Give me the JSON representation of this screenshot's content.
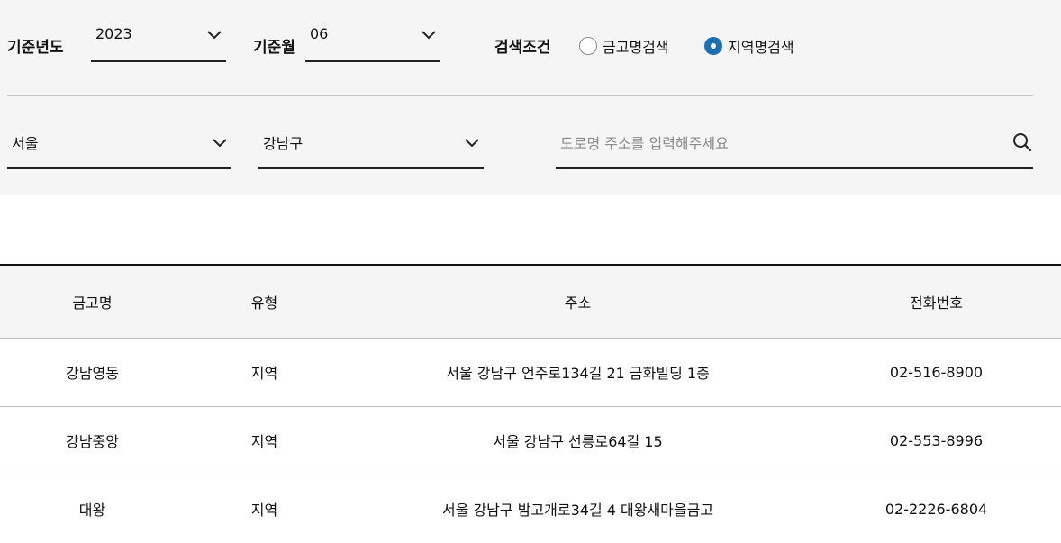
{
  "filters": {
    "year_label": "기준년도",
    "year_value": "2023",
    "month_label": "기준월",
    "month_value": "06",
    "search_condition_label": "검색조건",
    "radio_options": [
      {
        "label": "금고명검색",
        "checked": false
      },
      {
        "label": "지역명검색",
        "checked": true
      }
    ],
    "region_value": "서울",
    "district_value": "강남구",
    "address_placeholder": "도로명 주소를 입력해주세요",
    "address_value": ""
  },
  "table": {
    "headers": [
      "금고명",
      "유형",
      "주소",
      "전화번호"
    ],
    "rows": [
      [
        "강남영동",
        "지역",
        "서울 강남구 언주로134길 21 금화빌딩 1층",
        "02-516-8900"
      ],
      [
        "강남중앙",
        "지역",
        "서울 강남구 선릉로64길 15",
        "02-553-8996"
      ],
      [
        "대왕",
        "지역",
        "서울 강남구 밤고개로34길 4 대왕새마을금고",
        "02-2226-6804"
      ]
    ]
  },
  "colors": {
    "panel_bg": "#f5f5f5",
    "accent_radio": "#1a6fb5",
    "underline": "#222222"
  },
  "icons": [
    "chevron-down-icon",
    "search-icon"
  ]
}
